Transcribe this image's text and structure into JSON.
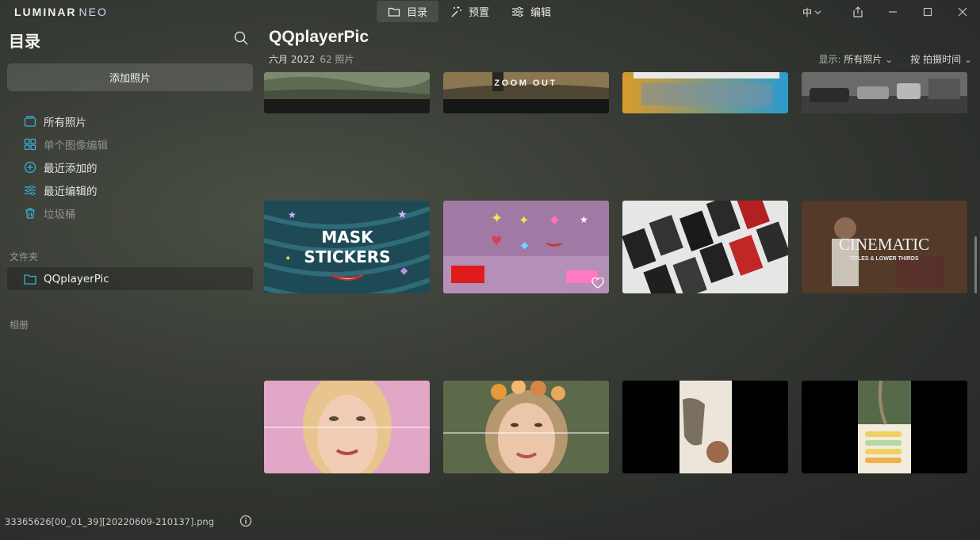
{
  "app": {
    "logo_main": "LUMINAR",
    "logo_sub": "NEO"
  },
  "modes": [
    {
      "label": "目录",
      "icon": "folder-icon",
      "active": true
    },
    {
      "label": "预置",
      "icon": "magic-wand-icon",
      "active": false
    },
    {
      "label": "编辑",
      "icon": "sliders-icon",
      "active": false
    }
  ],
  "window": {
    "language": "中",
    "buttons": [
      "share-icon",
      "minimize-icon",
      "maximize-icon",
      "close-icon"
    ]
  },
  "sidebar": {
    "title": "目录",
    "add_button": "添加照片",
    "nav": [
      {
        "label": "所有照片",
        "icon": "photos-icon",
        "dim": false
      },
      {
        "label": "单个图像编辑",
        "icon": "grid-icon",
        "dim": true
      },
      {
        "label": "最近添加的",
        "icon": "plus-circle-icon",
        "dim": false
      },
      {
        "label": "最近编辑的",
        "icon": "sliders-icon",
        "dim": false
      },
      {
        "label": "垃圾桶",
        "icon": "trash-icon",
        "dim": true
      }
    ],
    "folders_label": "文件夹",
    "folder": "QQplayerPic",
    "albums_label": "相册",
    "status_file": "33365626[00_01_39][20220609-210137].png"
  },
  "main": {
    "title": "QQplayerPic",
    "date": "六月 2022",
    "count": "62 照片",
    "display_label": "显示:",
    "display_value": "所有照片",
    "sort_label": "按 拍摄时间"
  },
  "thumbs": {
    "zoom_out": "ZOOM OUT",
    "mask_line1": "MASK",
    "mask_line2": "STICKERS",
    "cinematic": "CINEMATIC",
    "cinematic_sub": "TITLES & LOWER THIRDS"
  },
  "colors": {
    "accent": "#3ab0d8",
    "active_mode_bg": "#4a4c48"
  }
}
